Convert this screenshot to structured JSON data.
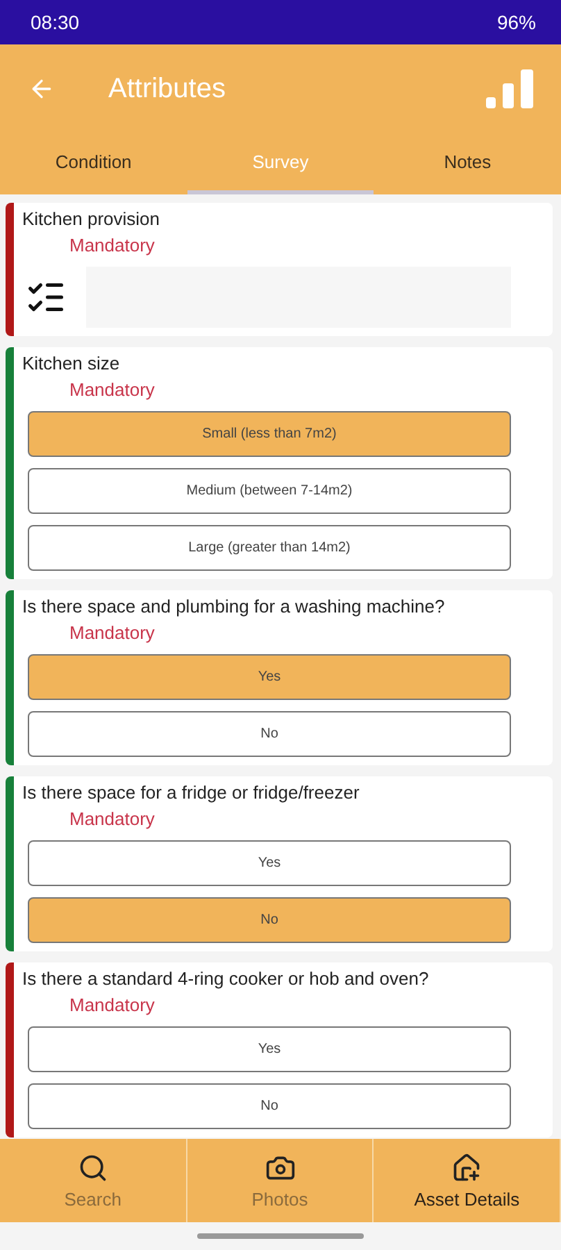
{
  "status_bar": {
    "time": "08:30",
    "battery": "96%"
  },
  "header": {
    "title": "Attributes"
  },
  "tabs": [
    {
      "label": "Condition",
      "selected": false
    },
    {
      "label": "Survey",
      "selected": true
    },
    {
      "label": "Notes",
      "selected": false
    }
  ],
  "questions": [
    {
      "kind": "list",
      "question": "Kitchen provision",
      "requirement": "Mandatory",
      "answered": false
    },
    {
      "kind": "choice",
      "question": "Kitchen size",
      "requirement": "Mandatory",
      "answered": true,
      "options": [
        {
          "label": "Small (less than 7m2)",
          "selected": true
        },
        {
          "label": "Medium (between 7-14m2)",
          "selected": false
        },
        {
          "label": "Large (greater than 14m2)",
          "selected": false
        }
      ]
    },
    {
      "kind": "choice",
      "question": "Is there space and plumbing for a washing machine?",
      "requirement": "Mandatory",
      "answered": true,
      "options": [
        {
          "label": "Yes",
          "selected": true
        },
        {
          "label": "No",
          "selected": false
        }
      ]
    },
    {
      "kind": "choice",
      "question": "Is there space for a fridge or fridge/freezer",
      "requirement": "Mandatory",
      "answered": true,
      "options": [
        {
          "label": "Yes",
          "selected": false
        },
        {
          "label": "No",
          "selected": true
        }
      ]
    },
    {
      "kind": "choice",
      "question": "Is there a standard 4-ring cooker or hob and oven?",
      "requirement": "Mandatory",
      "answered": false,
      "options": [
        {
          "label": "Yes",
          "selected": false
        },
        {
          "label": "No",
          "selected": false
        }
      ]
    }
  ],
  "bottom_nav": [
    {
      "label": "Search",
      "kind": "search",
      "disabled": true
    },
    {
      "label": "Photos",
      "kind": "camera",
      "disabled": true
    },
    {
      "label": "Asset Details",
      "kind": "house",
      "disabled": false
    }
  ]
}
